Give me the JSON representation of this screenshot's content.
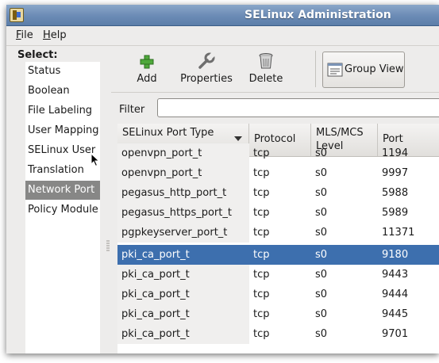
{
  "window": {
    "title": "SELinux Administration"
  },
  "menu": [
    {
      "label": "File"
    },
    {
      "label": "Help"
    }
  ],
  "sidebar": {
    "heading": "Select:",
    "items": [
      {
        "label": "Status"
      },
      {
        "label": "Boolean"
      },
      {
        "label": "File Labeling"
      },
      {
        "label": "User Mapping"
      },
      {
        "label": "SELinux User"
      },
      {
        "label": "Translation"
      },
      {
        "label": "Network Port"
      },
      {
        "label": "Policy Module"
      }
    ],
    "selected": "Network Port"
  },
  "toolbar": {
    "add_label": "Add",
    "properties_label": "Properties",
    "delete_label": "Delete",
    "group_view_label": "Group View"
  },
  "filter": {
    "label": "Filter",
    "value": ""
  },
  "table": {
    "columns": [
      "SELinux Port Type",
      "Protocol",
      "MLS/MCS Level",
      "Port"
    ],
    "sort_column": "SELinux Port Type",
    "rows": [
      {
        "type": "openvpn_port_t",
        "protocol": "tcp",
        "level": "s0",
        "port": "1194"
      },
      {
        "type": "openvpn_port_t",
        "protocol": "tcp",
        "level": "s0",
        "port": "9997"
      },
      {
        "type": "pegasus_http_port_t",
        "protocol": "tcp",
        "level": "s0",
        "port": "5988"
      },
      {
        "type": "pegasus_https_port_t",
        "protocol": "tcp",
        "level": "s0",
        "port": "5989"
      },
      {
        "type": "pgpkeyserver_port_t",
        "protocol": "tcp",
        "level": "s0",
        "port": "11371"
      },
      {
        "type": "pki_ca_port_t",
        "protocol": "tcp",
        "level": "s0",
        "port": "9180"
      },
      {
        "type": "pki_ca_port_t",
        "protocol": "tcp",
        "level": "s0",
        "port": "9443"
      },
      {
        "type": "pki_ca_port_t",
        "protocol": "tcp",
        "level": "s0",
        "port": "9444"
      },
      {
        "type": "pki_ca_port_t",
        "protocol": "tcp",
        "level": "s0",
        "port": "9445"
      },
      {
        "type": "pki_ca_port_t",
        "protocol": "tcp",
        "level": "s0",
        "port": "9701"
      }
    ],
    "selected_row": 5
  },
  "colors": {
    "selection": "#3d6fae",
    "sidebar_selected": "#878786",
    "titlebar": "#6b8bb5"
  },
  "icons": {
    "app": "selinux-app-icon",
    "add": "green-plus-icon",
    "properties": "wrench-icon",
    "delete": "trash-can-icon",
    "group_view": "list-view-icon"
  }
}
